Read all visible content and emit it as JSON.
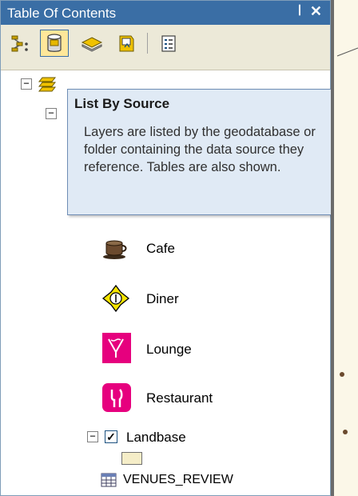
{
  "panel": {
    "title": "Table Of Contents",
    "pin_glyph": "ꟾ",
    "close_glyph": "✕"
  },
  "toolbar": {
    "buttons": [
      {
        "name": "list-by-drawing-order",
        "icon": "list-by-drawing-order-icon"
      },
      {
        "name": "list-by-source",
        "icon": "list-by-source-icon",
        "active": true
      },
      {
        "name": "list-by-visibility",
        "icon": "list-by-visibility-icon"
      },
      {
        "name": "list-by-selection",
        "icon": "list-by-selection-icon"
      },
      {
        "name": "options",
        "icon": "options-icon"
      }
    ]
  },
  "tooltip": {
    "title": "List By Source",
    "body": "Layers are listed by the geodatabase or folder containing the data source they reference. Tables are also shown."
  },
  "tree": {
    "legend": [
      {
        "label": "Cafe",
        "icon": "cafe-icon",
        "color": "#6b4a2e"
      },
      {
        "label": "Diner",
        "icon": "diner-icon",
        "color": "#f5e400"
      },
      {
        "label": "Lounge",
        "icon": "lounge-icon",
        "color": "#e6007e"
      },
      {
        "label": "Restaurant",
        "icon": "restaurant-icon",
        "color": "#e6007e"
      }
    ],
    "landbase": {
      "label": "Landbase",
      "checked": true,
      "swatch_color": "#f5edc8"
    },
    "table": {
      "label": "VENUES_REVIEW",
      "icon": "table-icon"
    }
  },
  "colors": {
    "title_bar": "#3a6ea5",
    "toolbar_bg": "#ece9d8",
    "tooltip_bg": "#e0eaf5",
    "map_bg": "#fbf7e8"
  }
}
